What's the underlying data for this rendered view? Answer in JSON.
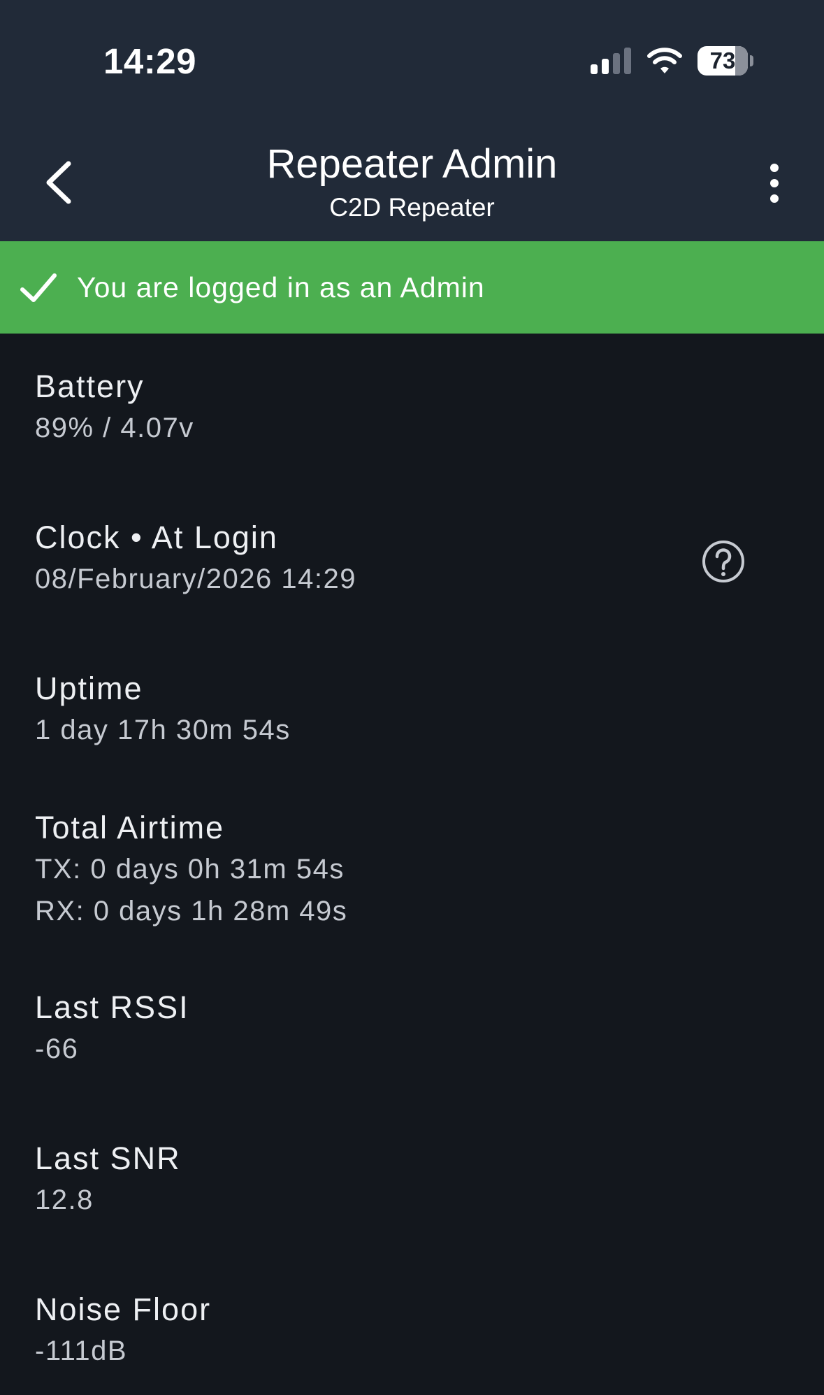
{
  "status_bar": {
    "time": "14:29",
    "battery_level": "73",
    "icons": [
      "signal-icon",
      "wifi-icon",
      "battery-icon"
    ]
  },
  "header": {
    "title": "Repeater Admin",
    "subtitle": "C2D Repeater",
    "back_icon": "chevron-left-icon",
    "more_icon": "more-vertical-icon"
  },
  "banner": {
    "text": "You are logged in as an Admin",
    "icon": "check-icon",
    "color": "#4caf50"
  },
  "stats": {
    "battery": {
      "label": "Battery",
      "value": "89% / 4.07v"
    },
    "clock": {
      "label": "Clock • At Login",
      "value": "08/February/2026 14:29",
      "icon": "help-icon"
    },
    "uptime": {
      "label": "Uptime",
      "value": "1 day 17h 30m 54s"
    },
    "airtime": {
      "label": "Total Airtime",
      "tx": "TX: 0 days 0h 31m 54s",
      "rx": "RX: 0 days 1h 28m 49s"
    },
    "rssi": {
      "label": "Last RSSI",
      "value": "-66"
    },
    "snr": {
      "label": "Last SNR",
      "value": "12.8"
    },
    "noise": {
      "label": "Noise Floor",
      "value": "-111dB"
    }
  },
  "colors": {
    "header_bg": "#212a38",
    "page_bg": "#13171d",
    "accent_green": "#4caf50"
  }
}
